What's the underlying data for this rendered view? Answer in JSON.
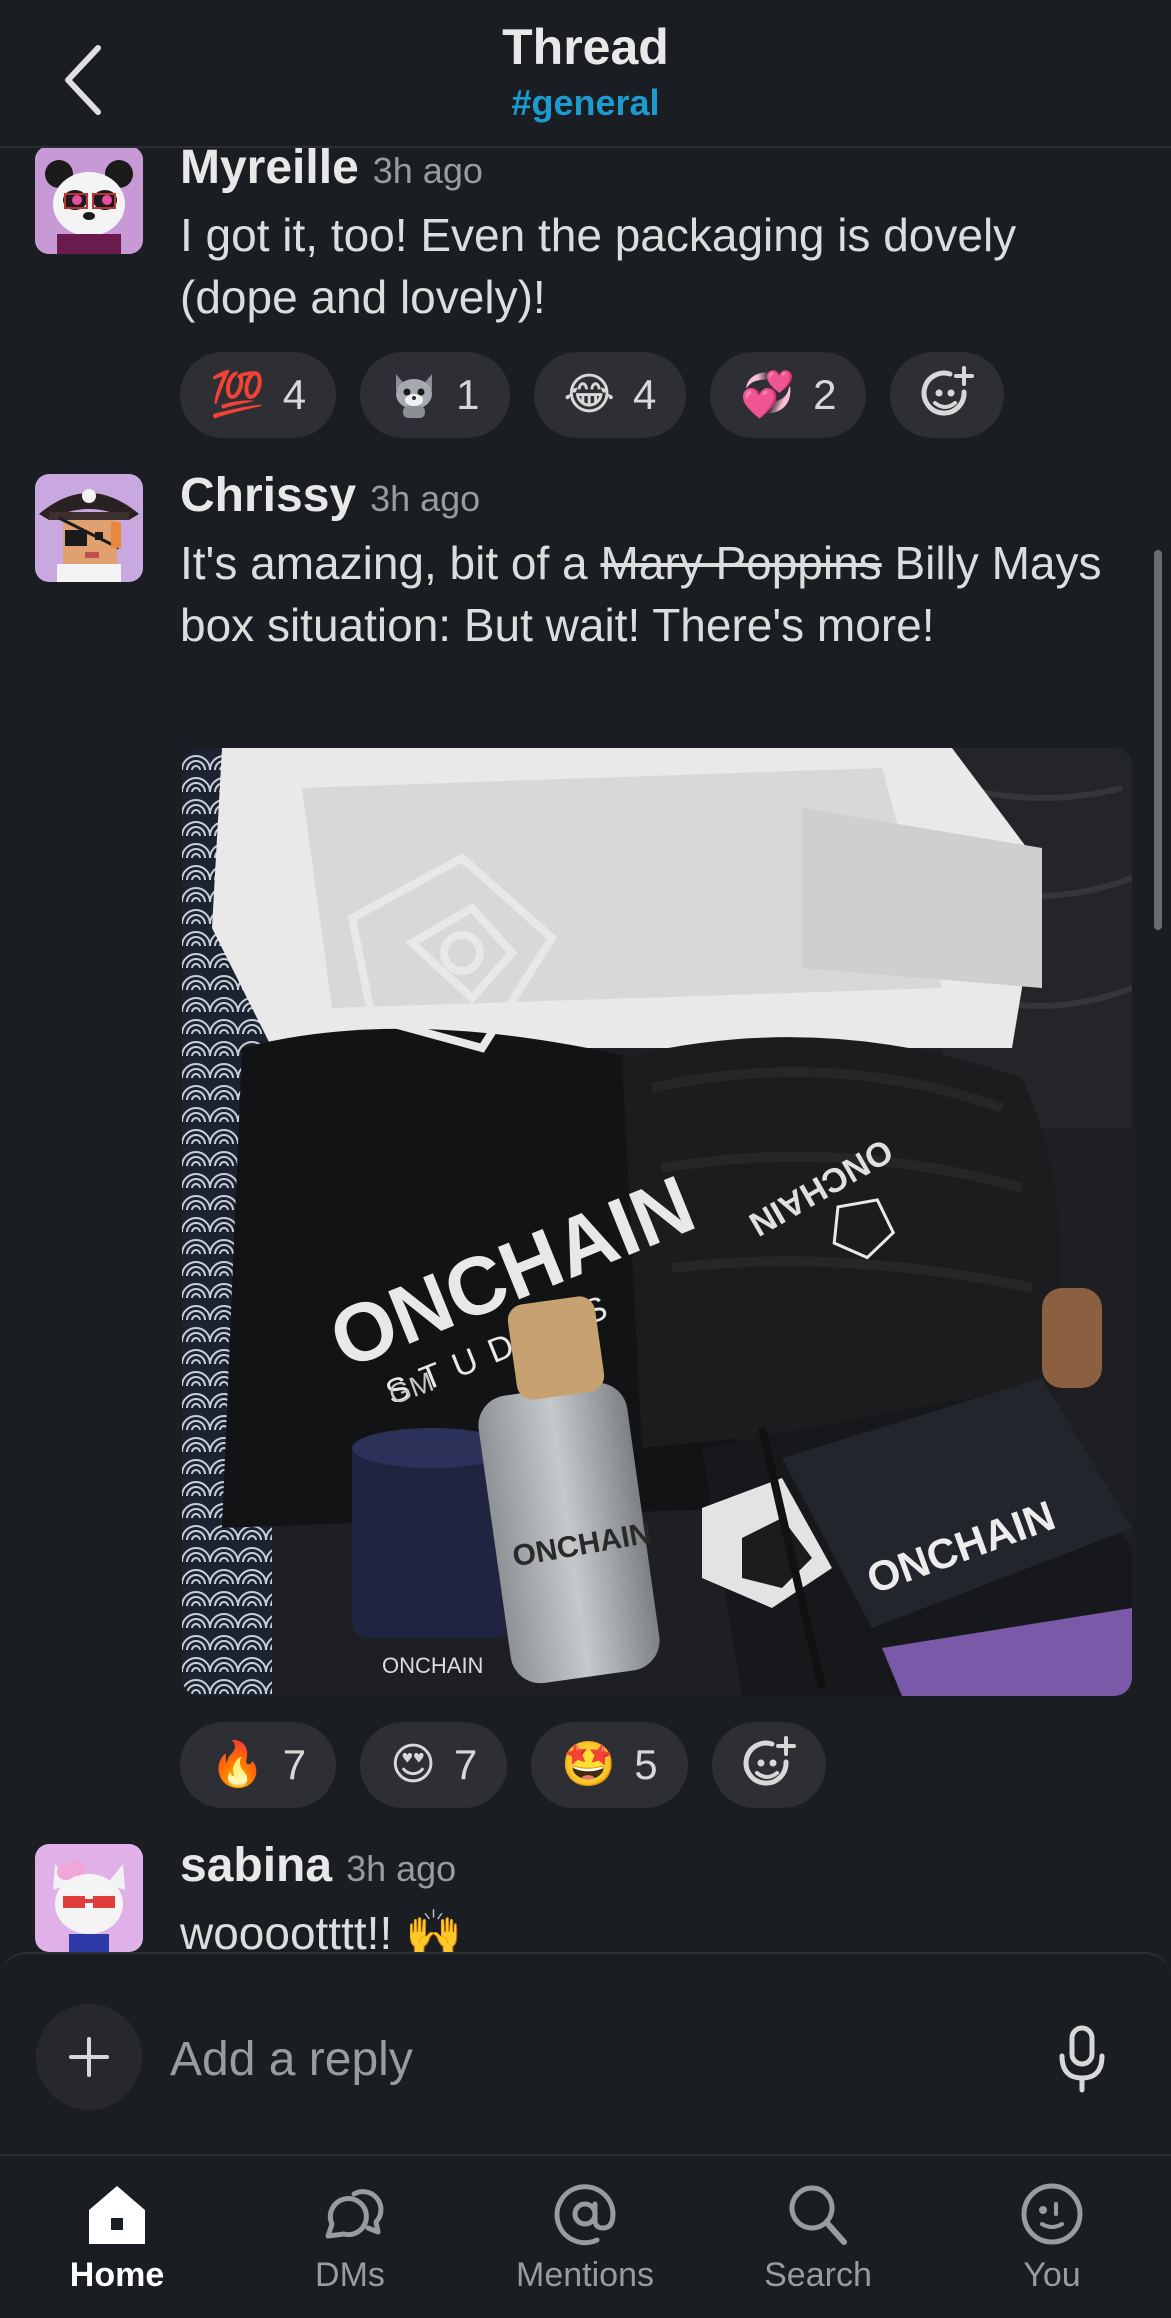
{
  "header": {
    "title": "Thread",
    "channel": "#general"
  },
  "messages": [
    {
      "author": "Myreille",
      "time": "3h ago",
      "text": "I got it, too! Even the packaging is dovely (dope and lovely)!",
      "reactions": [
        {
          "emoji": "💯",
          "count": "4"
        },
        {
          "emoji": "cat",
          "count": "1"
        },
        {
          "emoji": "😂",
          "count": "4"
        },
        {
          "emoji": "💞",
          "count": "2"
        }
      ]
    },
    {
      "author": "Chrissy",
      "time": "3h ago",
      "text_before": "It's amazing, bit of a ",
      "text_strike": "Mary Poppins",
      "text_after": " Billy Mays box situation: But wait! There's more!",
      "image_labels": {
        "logo": "ONCHAIN",
        "studios": "STUDIOS",
        "gm": "GM"
      },
      "reactions": [
        {
          "emoji": "🔥",
          "count": "7"
        },
        {
          "emoji": "😍",
          "count": "7"
        },
        {
          "emoji": "🤩",
          "count": "5"
        }
      ]
    },
    {
      "author": "sabina",
      "time": "3h ago",
      "text": "wooootttt!! 🙌"
    }
  ],
  "composer": {
    "placeholder": "Add a reply"
  },
  "nav": [
    {
      "label": "Home",
      "icon": "home-icon",
      "active": true
    },
    {
      "label": "DMs",
      "icon": "dms-icon"
    },
    {
      "label": "Mentions",
      "icon": "mentions-icon"
    },
    {
      "label": "Search",
      "icon": "search-icon"
    },
    {
      "label": "You",
      "icon": "you-icon"
    }
  ],
  "colors": {
    "background": "#1a1d21",
    "channel_link": "#1d9bd1",
    "pill": "#2d2f34"
  }
}
